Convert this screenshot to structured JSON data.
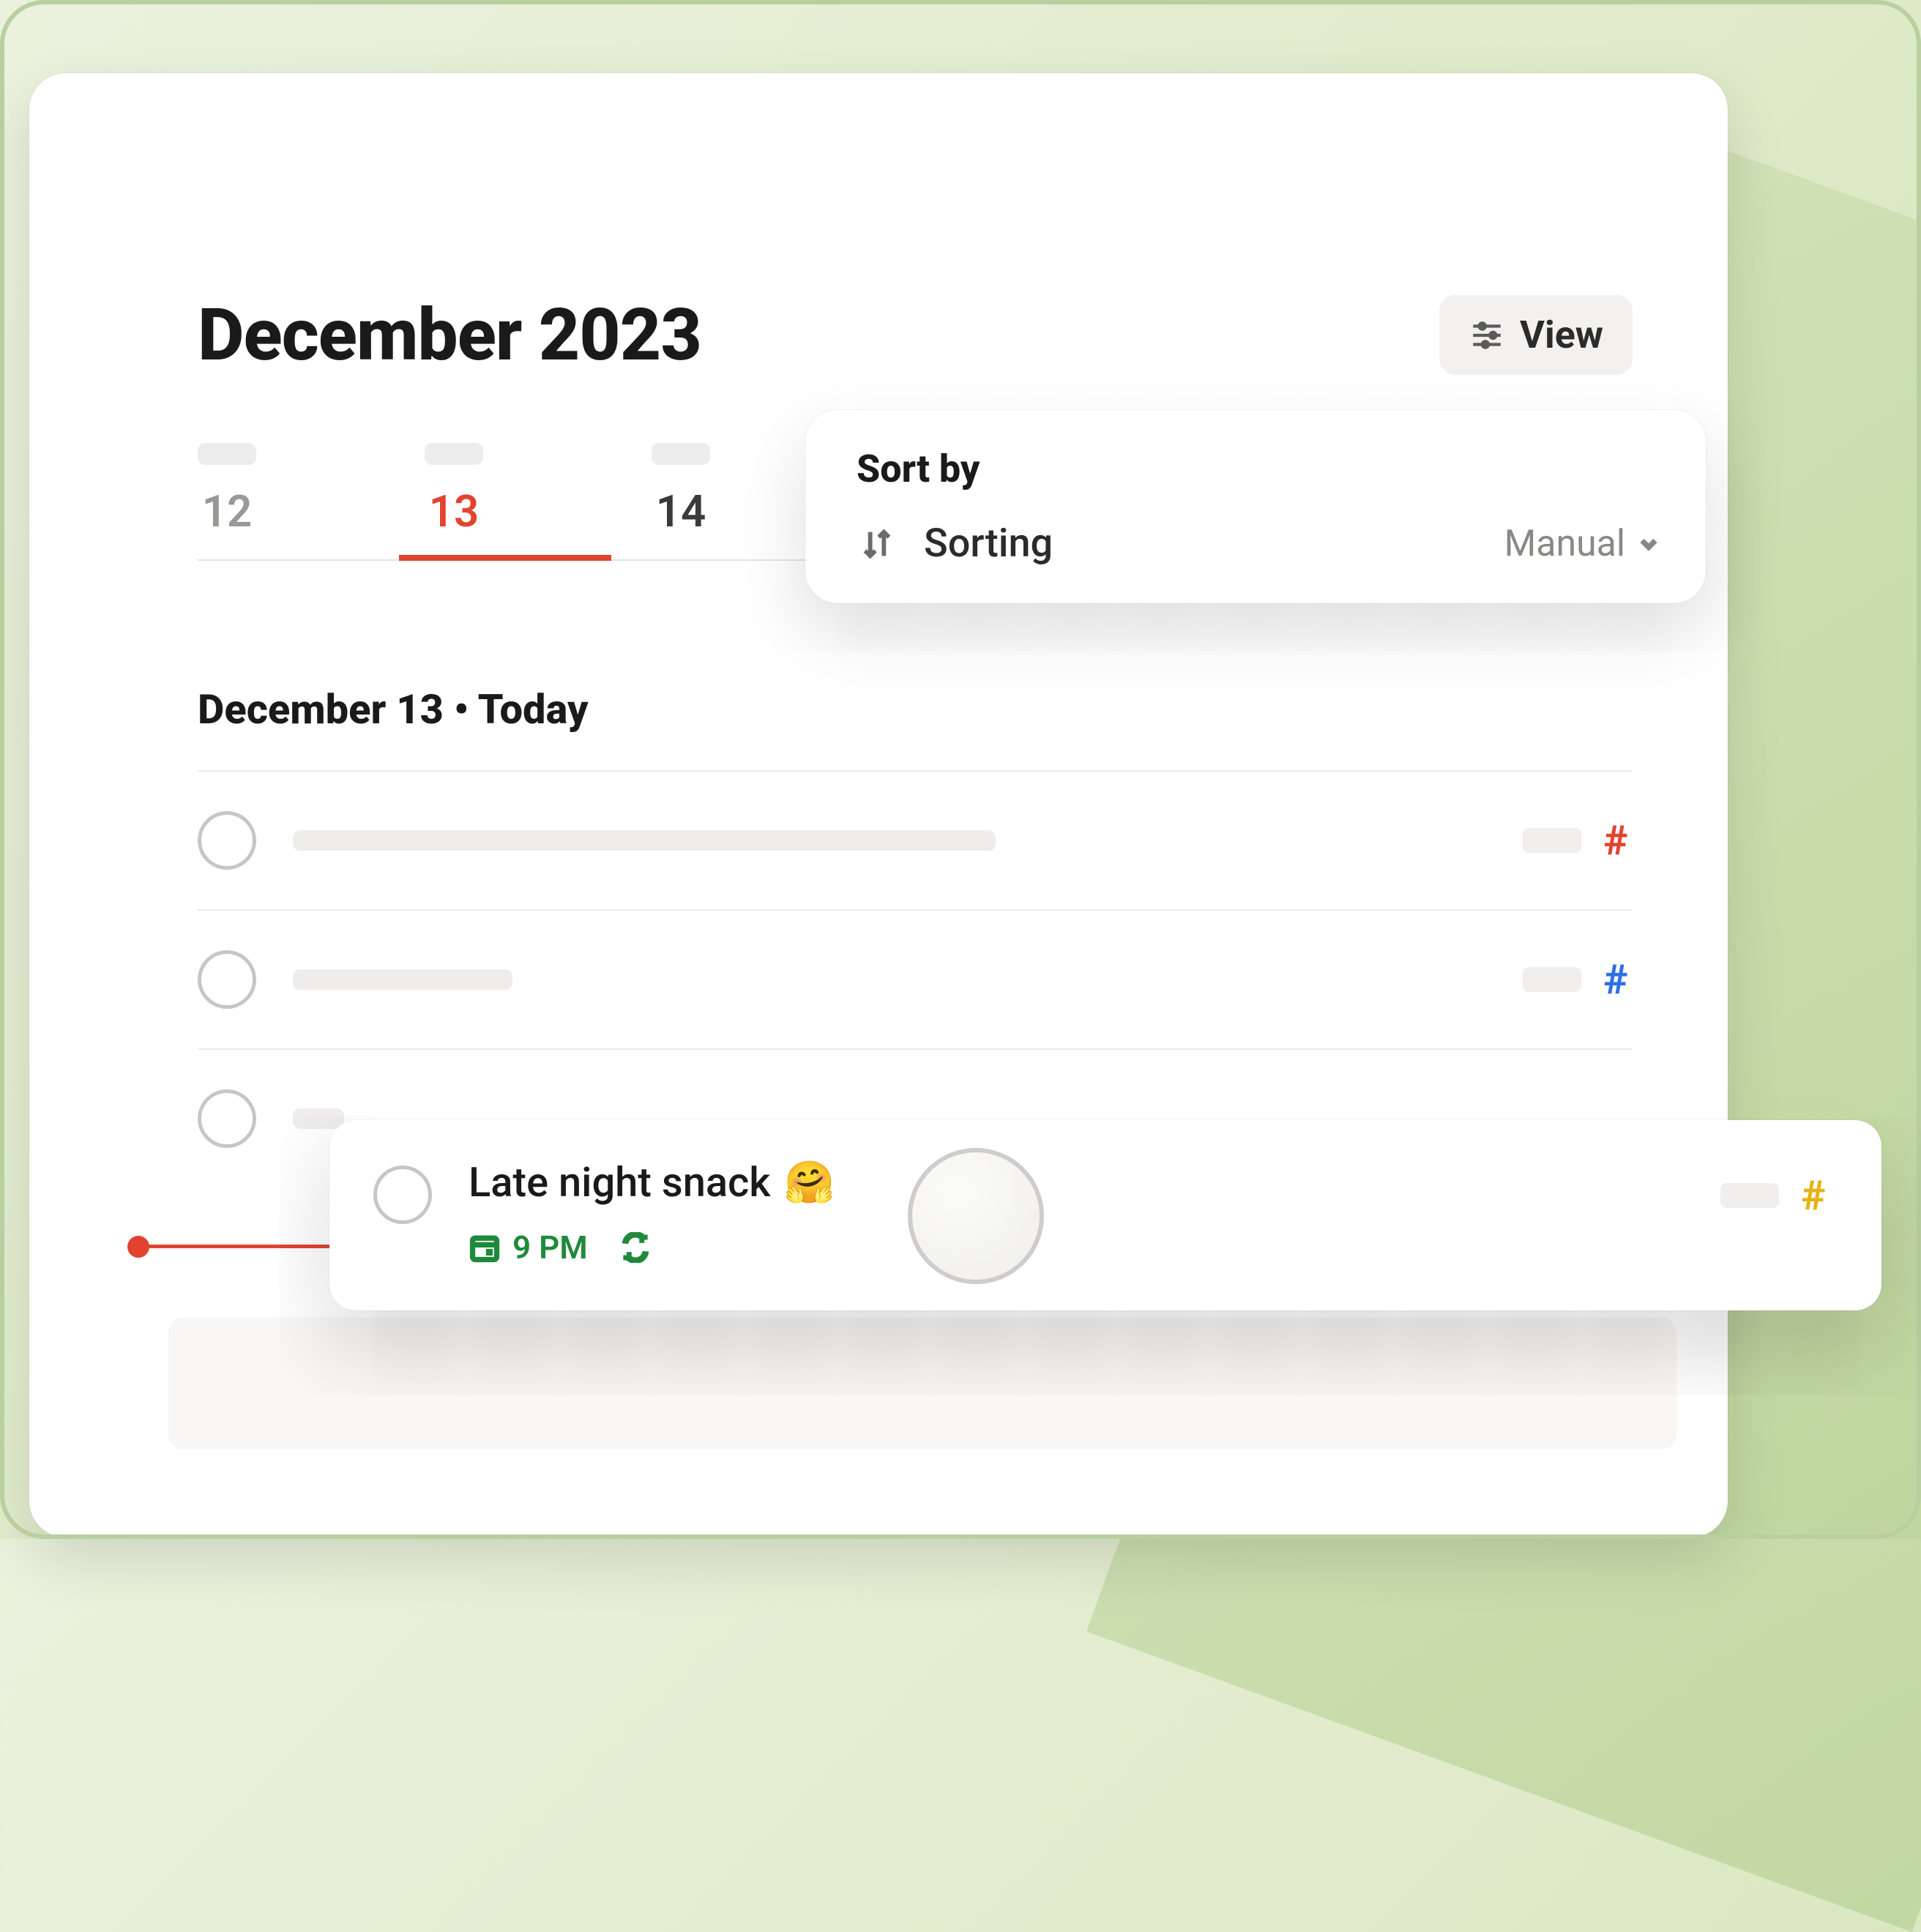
{
  "header": {
    "title": "December 2023",
    "view_label": "View"
  },
  "dates": [
    {
      "num": "12"
    },
    {
      "num": "13"
    },
    {
      "num": "14"
    }
  ],
  "sort_popover": {
    "title": "Sort by",
    "row_label": "Sorting",
    "value": "Manual"
  },
  "section": {
    "heading": "December 13 • Today"
  },
  "tasks": {
    "row1_hash": "#",
    "row2_hash": "#",
    "row3_hash": "#"
  },
  "drag_task": {
    "title": "Late night snack",
    "emoji": "🤗",
    "time": "9 PM",
    "hash": "#"
  },
  "colors": {
    "accent": "#e24330",
    "green": "#1f8a3b",
    "blue": "#2f6fe6",
    "yellow": "#e4b214"
  }
}
